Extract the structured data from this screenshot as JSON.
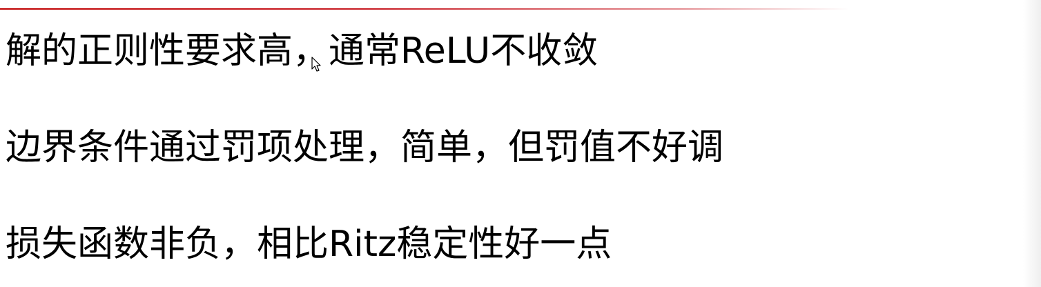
{
  "slide": {
    "bullets": [
      "解的正则性要求高，通常ReLU不收敛",
      "边界条件通过罚项处理，简单，但罚值不好调",
      "损失函数非负，相比Ritz稳定性好一点"
    ]
  },
  "colors": {
    "accent_rule": "#c00000",
    "text": "#000000",
    "background": "#ffffff"
  },
  "icons": {
    "cursor": "mouse-pointer-icon"
  }
}
